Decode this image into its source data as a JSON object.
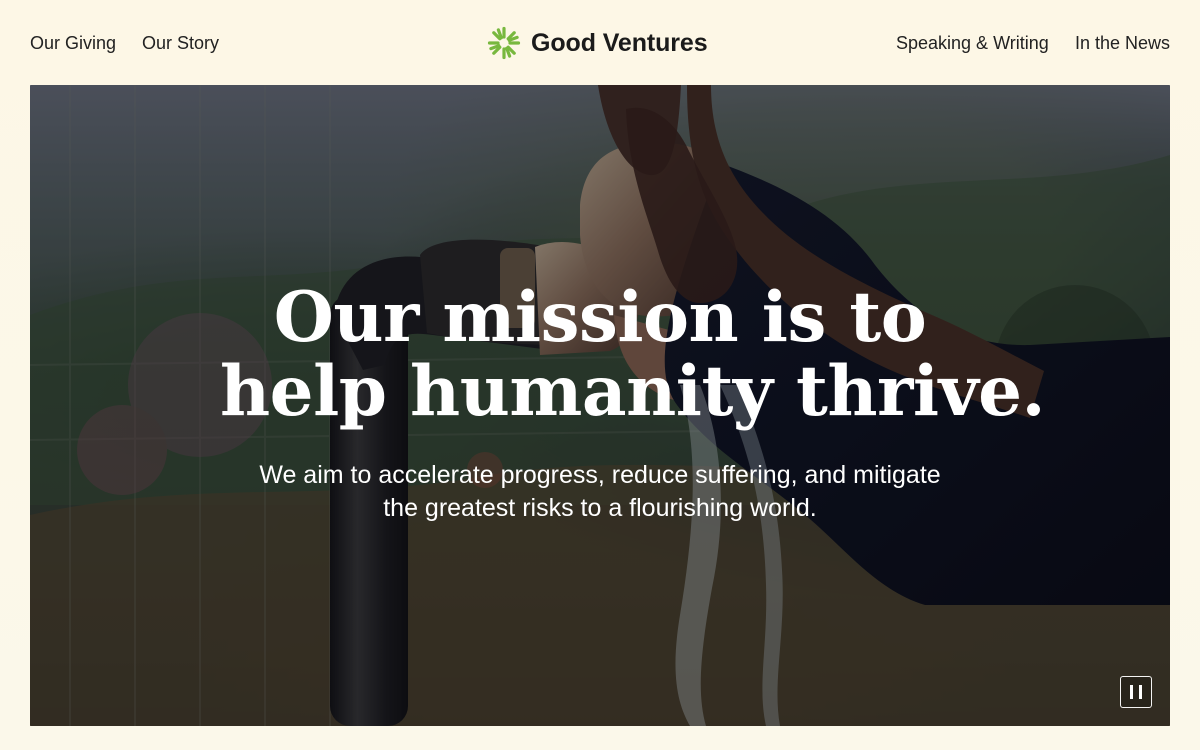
{
  "nav": {
    "left": [
      {
        "label": "Our Giving"
      },
      {
        "label": "Our Story"
      }
    ],
    "right": [
      {
        "label": "Speaking & Writing"
      },
      {
        "label": "In the News"
      }
    ]
  },
  "brand": {
    "name": "Good Ventures",
    "icon": "green-starburst-logo-icon",
    "color": "#78b83e"
  },
  "hero": {
    "heading_lines": [
      "Our mission is to",
      "help humanity thrive."
    ],
    "subtitle_lines": [
      "We aim to accelerate progress, reduce suffering, and mitigate",
      "the greatest risks to a flourishing world."
    ],
    "pause_icon": "pause-icon"
  }
}
